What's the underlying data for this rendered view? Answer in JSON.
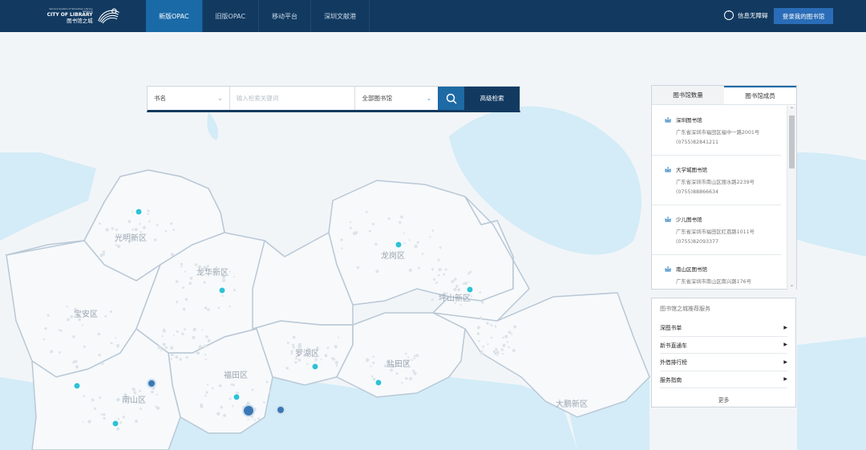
{
  "header": {
    "logo_small": "Service System of Shenzhen Library Network",
    "logo_en": "CITY OF LIBRARY",
    "logo_cn": "图书馆之城",
    "nav": [
      "新版OPAC",
      "旧版OPAC",
      "移动平台",
      "深圳文献港"
    ],
    "active_nav": 0,
    "accessibility_label": "信息无障碍",
    "login_label": "登录我的图书馆"
  },
  "search": {
    "field_type": "书名",
    "keyword_placeholder": "输入检索关键词",
    "library_scope": "全部图书馆",
    "advanced_label": "高级检索"
  },
  "panel": {
    "tabs": [
      "图书馆数量",
      "图书馆成员"
    ],
    "active_tab": 1,
    "libraries": [
      {
        "name": "深圳图书馆",
        "address": "广东省深圳市福田区福中一路2001号",
        "phone": "(0755)82841211"
      },
      {
        "name": "大学城图书馆",
        "address": "广东省深圳市南山区丽水路2239号",
        "phone": "(0755)88866634"
      },
      {
        "name": "少儿图书馆",
        "address": "广东省深圳市福田区红荔路1011号",
        "phone": "(0755)82093377"
      },
      {
        "name": "南山区图书馆",
        "address": "广东省深圳市南山区南兴路176号",
        "phone": ""
      }
    ]
  },
  "services": {
    "title": "图书馆之城推荐服务",
    "items": [
      "深图书单",
      "新书直通车",
      "外借排行榜",
      "服务指南"
    ],
    "more_label": "更多"
  },
  "map": {
    "districts": [
      "光明新区",
      "龙华新区",
      "宝安区",
      "龙岗区",
      "坪山新区",
      "罗湖区",
      "福田区",
      "盐田区",
      "南山区",
      "大鹏新区"
    ],
    "colors": {
      "land": "#f7f9fb",
      "border": "#b9c8d6",
      "sea": "#d3ecf7",
      "label": "#9aa6b2",
      "marker_cyan": "#2fc2d6",
      "marker_blue": "#3a78b5"
    }
  }
}
